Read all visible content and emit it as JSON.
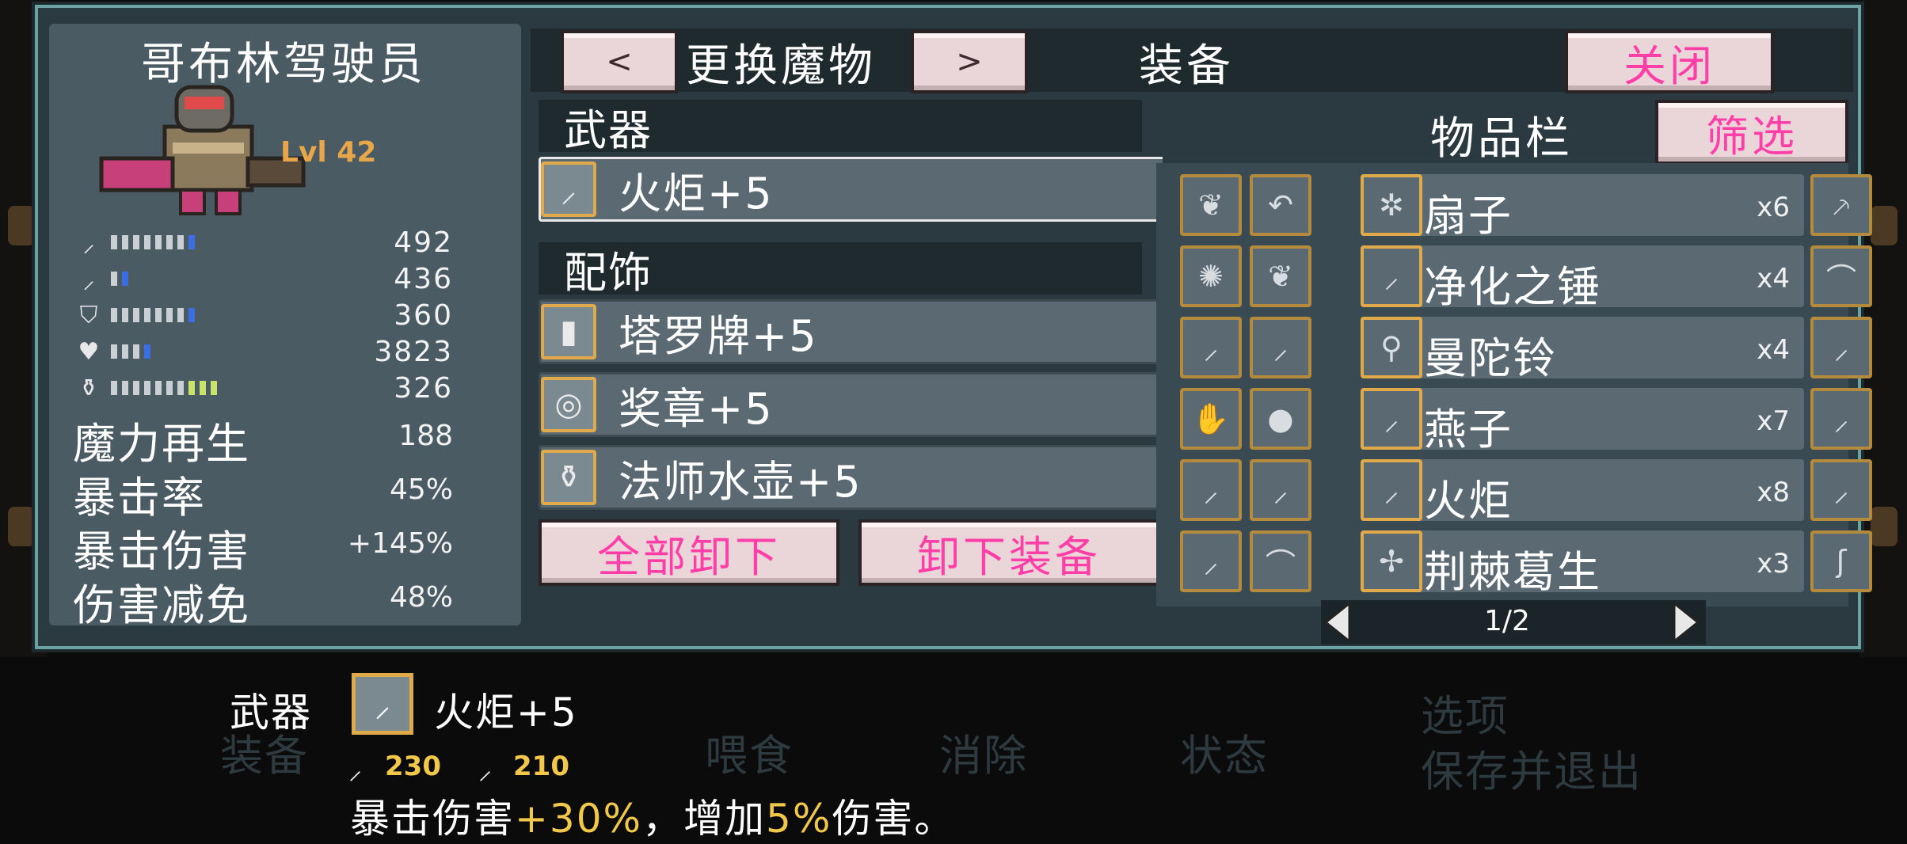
{
  "monster": {
    "name": "哥布林驾驶员",
    "level": "Lvl 42",
    "prev_button": "<",
    "next_button": ">",
    "change_label": "更换魔物"
  },
  "header": {
    "title": "装备",
    "close_label": "关闭"
  },
  "stats": [
    {
      "icon": "sword-icon",
      "glyph": "🗡",
      "value": "492",
      "bar": 0.6
    },
    {
      "icon": "wand-icon",
      "glyph": "⁄",
      "value": "436",
      "bar": 0.1
    },
    {
      "icon": "shield-icon",
      "glyph": "⛉",
      "value": "360",
      "bar": 0.8
    },
    {
      "icon": "heart-icon",
      "glyph": "♥",
      "value": "3823",
      "bar": 0.3
    },
    {
      "icon": "potion-icon",
      "glyph": "⚱",
      "value": "326",
      "bar": 1.0
    }
  ],
  "text_stats": [
    {
      "label": "魔力再生",
      "value": "188"
    },
    {
      "label": "暴击率",
      "value": "45%"
    },
    {
      "label": "暴击伤害",
      "value": "+145%"
    },
    {
      "label": "伤害减免",
      "value": "48%"
    }
  ],
  "weapon_section": {
    "title": "武器",
    "item": "火炬+5",
    "icon": "torch-icon"
  },
  "accessory_section": {
    "title": "配饰",
    "items": [
      {
        "name": "塔罗牌+5",
        "icon": "tarot-card-icon",
        "glyph": "▮"
      },
      {
        "name": "奖章+5",
        "icon": "medal-icon",
        "glyph": "◎"
      },
      {
        "name": "法师水壶+5",
        "icon": "flask-icon",
        "glyph": "⚱"
      }
    ]
  },
  "actions": {
    "unequip_all": "全部卸下",
    "unequip": "卸下装备"
  },
  "inventory": {
    "title": "物品栏",
    "filter_label": "筛选",
    "page": "1/2",
    "rows": [
      {
        "left": [
          "feather-icon",
          "scythe-icon"
        ],
        "name": "扇子",
        "qty": "x6",
        "icon": "fan-icon",
        "right": "brush-icon"
      },
      {
        "left": [
          "bomb-icon",
          "feather-icon"
        ],
        "name": "净化之锤",
        "qty": "x4",
        "icon": "hammer-icon",
        "right": "whip-icon"
      },
      {
        "left": [
          "dagger-icon",
          "staff-icon"
        ],
        "name": "曼陀铃",
        "qty": "x4",
        "icon": "mandolin-icon",
        "right": "mace-icon"
      },
      {
        "left": [
          "glove-icon",
          "orb-icon"
        ],
        "name": "燕子",
        "qty": "x7",
        "icon": "swallow-icon",
        "right": "sword-icon"
      },
      {
        "left": [
          "wand-icon",
          "blade-icon"
        ],
        "name": "火炬",
        "qty": "x8",
        "icon": "torch-icon",
        "right": "club-icon"
      },
      {
        "left": [
          "flail-icon",
          "horn-icon"
        ],
        "name": "荆棘葛生",
        "qty": "x3",
        "icon": "thorn-icon",
        "right": "hook-icon"
      }
    ]
  },
  "bottom": {
    "label": "武器",
    "item": "火炬+5",
    "attack": "230",
    "magic": "210",
    "desc_a": "暴击伤害",
    "desc_b": "+30%",
    "desc_c": "，增加",
    "desc_d": "5%",
    "desc_e": "伤害。"
  },
  "colors": {
    "accent_pink": "#ff3ea8",
    "level_orange": "#e8a64a",
    "slot_gold": "#e0a94a",
    "window_border": "#6ba2a2"
  }
}
